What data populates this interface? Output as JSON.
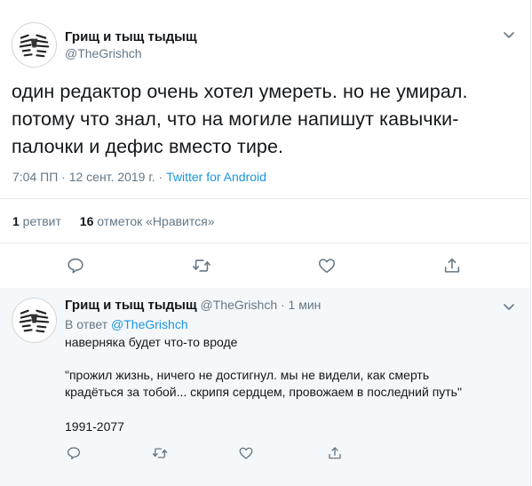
{
  "main_tweet": {
    "display_name": "Грищ и тыщ тыдыщ",
    "handle": "@TheGrishch",
    "text_lines": [
      "один редактор очень хотел умереть. но не умирал.",
      "потому что знал, что на могиле напишут кавычки-",
      "палочки и дефис вместо тире."
    ],
    "time": "7:04 ПП · 12 сент. 2019 г. · ",
    "source": "Twitter for Android",
    "retweet_count": "1",
    "retweet_label": " ретвит",
    "like_count": "16",
    "like_label": " отметок «Нравится»"
  },
  "reply_tweet": {
    "display_name": "Грищ и тыщ тыдыщ",
    "handle_time": " @TheGrishch · 1 мин",
    "in_reply_prefix": "В ответ ",
    "in_reply_handle": "@TheGrishch",
    "line1": "наверняка будет что-то вроде",
    "line2": "\"прожил жизнь, ничего не достигнул. мы не видели, как смерть",
    "line3": "крадёться за тобой... скрипя сердцем, провожаем в последний путь\"",
    "line4": "1991-2077"
  },
  "icons": {
    "reply": "reply-icon",
    "retweet": "retweet-icon",
    "like": "heart-icon",
    "share": "share-icon",
    "menu": "chevron-down-icon"
  },
  "colors": {
    "link": "#1b95e0",
    "secondary_text": "#657786",
    "reply_background": "#f5f8fa"
  }
}
